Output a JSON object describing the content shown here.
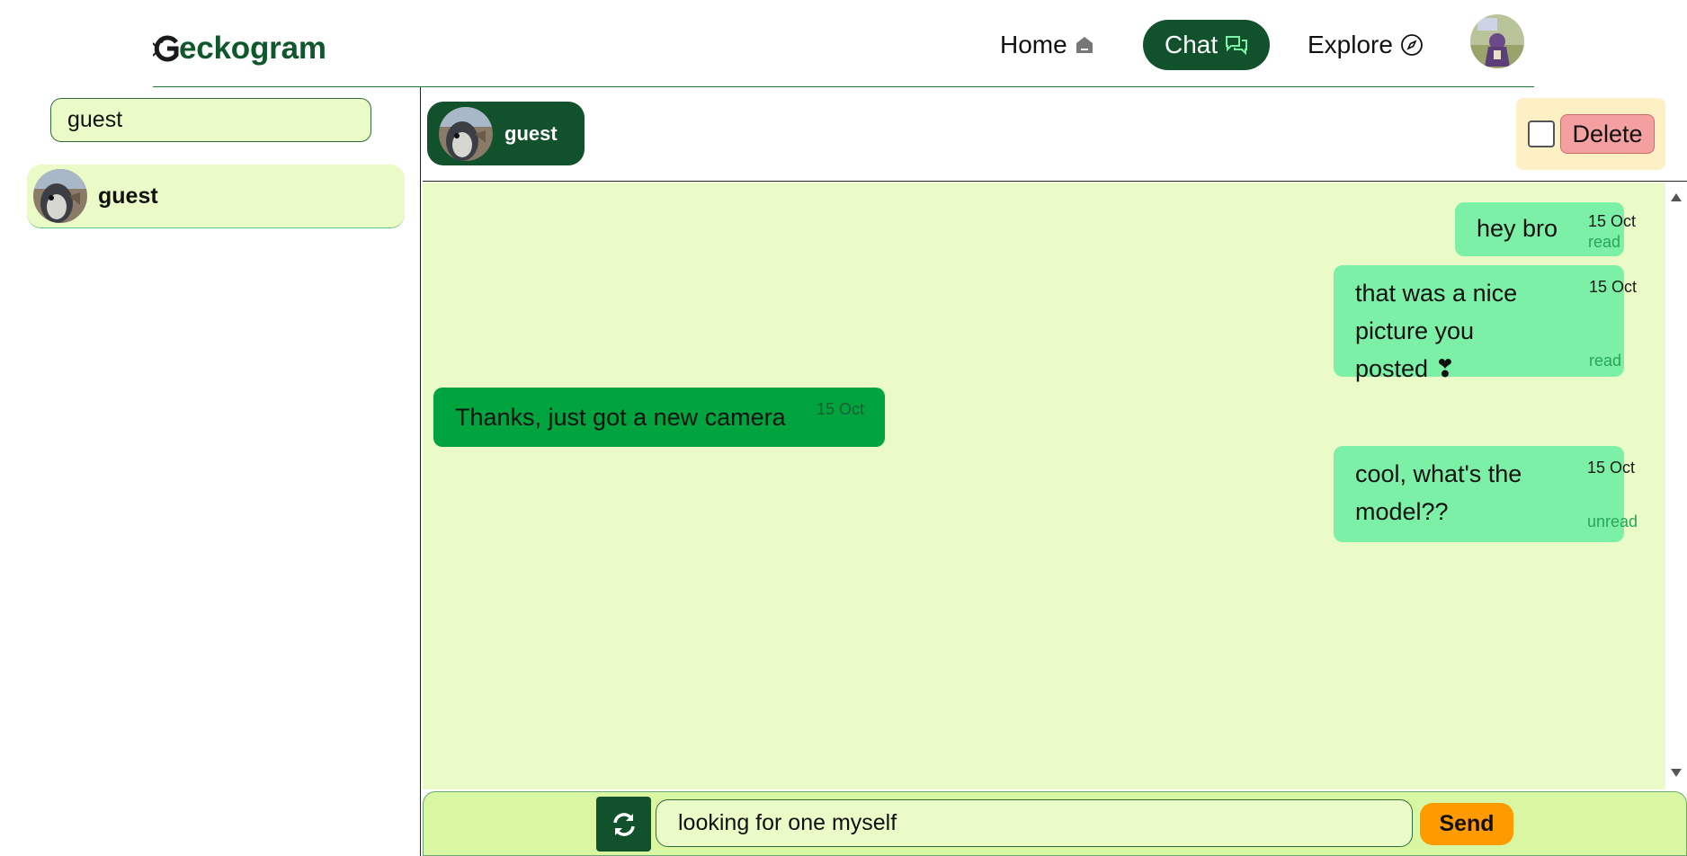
{
  "app": {
    "logo_text": "eckogram",
    "logo_icon": "gecko-g-icon"
  },
  "nav": {
    "home": {
      "label": "Home",
      "icon": "home-icon"
    },
    "chat": {
      "label": "Chat",
      "icon": "chat-bubbles-icon"
    },
    "explore": {
      "label": "Explore",
      "icon": "compass-icon"
    }
  },
  "sidebar": {
    "search_value": "guest",
    "contacts": [
      {
        "name": "guest"
      }
    ]
  },
  "chat": {
    "user_name": "guest",
    "delete_label": "Delete",
    "messages": [
      {
        "direction": "out",
        "text": "hey bro",
        "date": "15 Oct",
        "status": "read"
      },
      {
        "direction": "out",
        "text": "that was a nice picture you posted ❣",
        "date": "15 Oct",
        "status": "read"
      },
      {
        "direction": "in",
        "text": "Thanks, just got a new camera",
        "date": "15 Oct",
        "status": ""
      },
      {
        "direction": "out",
        "text": "cool, what's the model??",
        "date": "15 Oct",
        "status": "unread"
      }
    ],
    "composer": {
      "input_value": "looking for one myself",
      "send_label": "Send"
    }
  },
  "colors": {
    "brand_dark": "#11522c",
    "chat_bg": "#eafbc8",
    "outgoing": "#7cf0a6",
    "incoming": "#00a43f",
    "send": "#ff9a00",
    "delete": "#f4a0a0"
  }
}
